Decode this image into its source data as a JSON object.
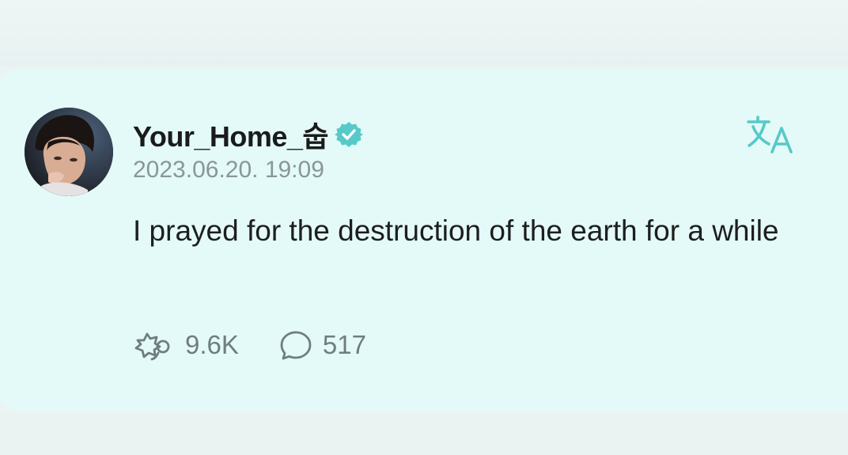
{
  "post": {
    "username": "Your_Home_숩",
    "timestamp": "2023.06.20. 19:09",
    "text": "I prayed for the destruction of the earth for a while",
    "likes": "9.6K",
    "comments": "517"
  },
  "icons": {
    "verified": "verified-badge-icon",
    "translate": "translate-icon",
    "like": "like-icon",
    "comment": "comment-icon"
  },
  "colors": {
    "card_background": "#e3faf8",
    "accent": "#57c9c9",
    "text": "#1e1e1e",
    "muted": "#8a9697"
  }
}
